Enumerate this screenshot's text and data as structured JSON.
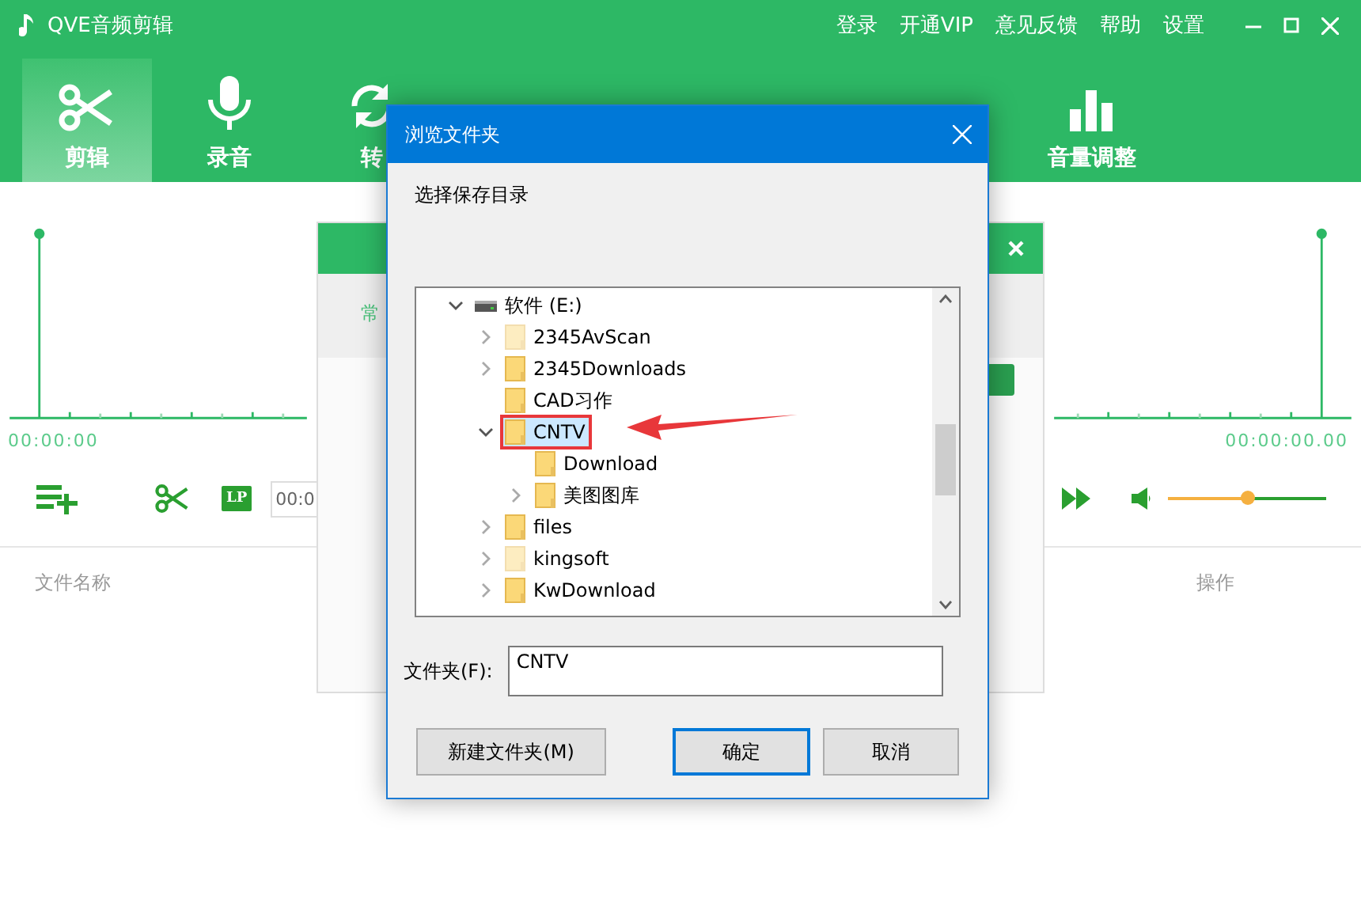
{
  "app": {
    "title": "QVE音频剪辑",
    "menu": [
      "登录",
      "开通VIP",
      "意见反馈",
      "帮助",
      "设置"
    ],
    "tabs": [
      {
        "label": "剪辑",
        "selected": true
      },
      {
        "label": "录音",
        "selected": false
      },
      {
        "label": "转",
        "selected": false
      },
      {
        "label": "音量调整",
        "selected": false
      }
    ],
    "start_time": "00:00:00",
    "end_time": "00:00:00.00",
    "lp_badge": "LP",
    "time_field": "00:0",
    "volume": {
      "level": 0.5
    },
    "columns": [
      "文件名称",
      "操作"
    ]
  },
  "panel": {
    "tab": "常"
  },
  "dialog": {
    "title": "浏览文件夹",
    "prompt": "选择保存目录",
    "tree": [
      {
        "label": "软件 (E:)",
        "kind": "drive",
        "expanded": true,
        "dimmed": false,
        "selected": false,
        "marked": false,
        "children": [
          {
            "label": "2345AvScan",
            "kind": "folder",
            "expanded": false,
            "dimmed": true,
            "selected": false,
            "marked": false
          },
          {
            "label": "2345Downloads",
            "kind": "folder",
            "expanded": false,
            "dimmed": false,
            "selected": false,
            "marked": false
          },
          {
            "label": "CAD习作",
            "kind": "folder",
            "dimmed": false,
            "selected": false,
            "marked": false
          },
          {
            "label": "CNTV",
            "kind": "folder",
            "expanded": true,
            "dimmed": false,
            "selected": true,
            "marked": true,
            "children": [
              {
                "label": "Download",
                "kind": "folder",
                "dimmed": false,
                "selected": false,
                "marked": false
              },
              {
                "label": "美图图库",
                "kind": "folder",
                "expanded": false,
                "dimmed": false,
                "selected": false,
                "marked": false
              }
            ]
          },
          {
            "label": "files",
            "kind": "folder",
            "expanded": false,
            "dimmed": false,
            "selected": false,
            "marked": false
          },
          {
            "label": "kingsoft",
            "kind": "folder",
            "expanded": false,
            "dimmed": true,
            "selected": false,
            "marked": false
          },
          {
            "label": "KwDownload",
            "kind": "folder",
            "expanded": false,
            "dimmed": false,
            "selected": false,
            "marked": false
          }
        ]
      }
    ],
    "folder_label": "文件夹(F):",
    "folder_value": "CNTV",
    "buttons": [
      {
        "label": "新建文件夹(M)",
        "default": false
      },
      {
        "label": "确定",
        "default": true
      },
      {
        "label": "取消",
        "default": false
      }
    ]
  }
}
